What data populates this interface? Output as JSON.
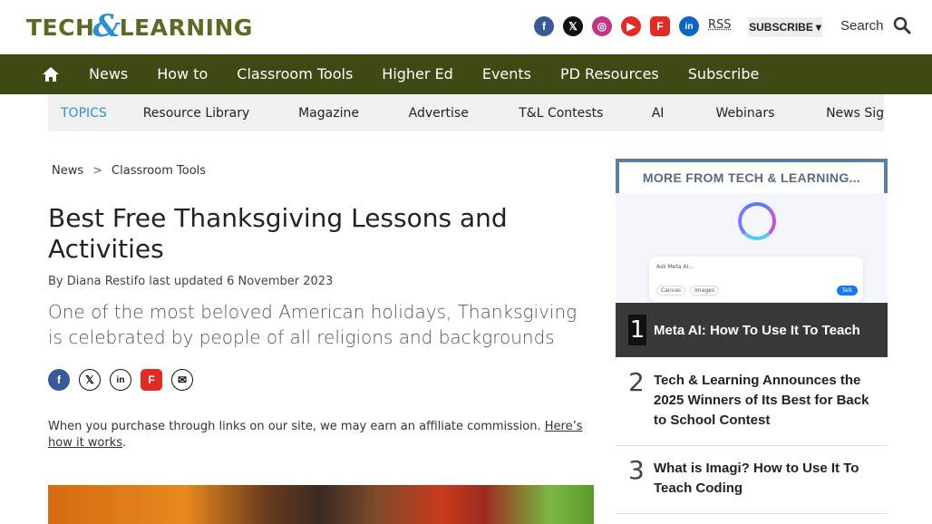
{
  "header": {
    "logo": {
      "part1": "TECH",
      "amp": "&",
      "part2": "LEARNING"
    },
    "social": [
      {
        "name": "facebook-icon",
        "glyph": "f"
      },
      {
        "name": "x-icon",
        "glyph": "𝕏"
      },
      {
        "name": "instagram-icon",
        "glyph": "◎"
      },
      {
        "name": "youtube-icon",
        "glyph": "▶"
      },
      {
        "name": "flipboard-icon",
        "glyph": "F"
      },
      {
        "name": "linkedin-icon",
        "glyph": "in"
      }
    ],
    "rss": "RSS",
    "subscribe": "SUBSCRIBE",
    "search": "Search"
  },
  "nav": {
    "items": [
      "News",
      "How to",
      "Classroom Tools",
      "Higher Ed",
      "Events",
      "PD Resources",
      "Subscribe"
    ]
  },
  "topics": {
    "label": "TOPICS",
    "items": [
      "Resource Library",
      "Magazine",
      "Advertise",
      "T&L Contests",
      "AI",
      "Webinars",
      "News Sig"
    ]
  },
  "breadcrumb": {
    "first": "News",
    "sep": ">",
    "second": "Classroom Tools"
  },
  "article": {
    "title": "Best Free Thanksgiving Lessons and Activities",
    "byline_prefix": "By",
    "author": "Diana Restifo",
    "updated": "last updated 6 November 2023",
    "standfirst": "One of the most beloved American holidays, Thanksgiving is celebrated by people of all religions and backgrounds",
    "affiliate_text": "When you purchase through links on our site, we may earn an affiliate commission.",
    "affiliate_link": "Here’s how it works",
    "affiliate_end": "."
  },
  "sidebar": {
    "header": "MORE FROM TECH & LEARNING...",
    "promo": {
      "ask": "Ask Meta AI...",
      "chip1": "Canvas",
      "chip2": "Images",
      "talk": "Talk"
    },
    "items": [
      {
        "num": "1",
        "title": "Meta AI: How To Use It To Teach"
      },
      {
        "num": "2",
        "title": "Tech & Learning Announces the 2025 Winners of Its Best for Back to School Contest"
      },
      {
        "num": "3",
        "title": "What is Imagi? How to Use It To Teach Coding"
      }
    ]
  }
}
